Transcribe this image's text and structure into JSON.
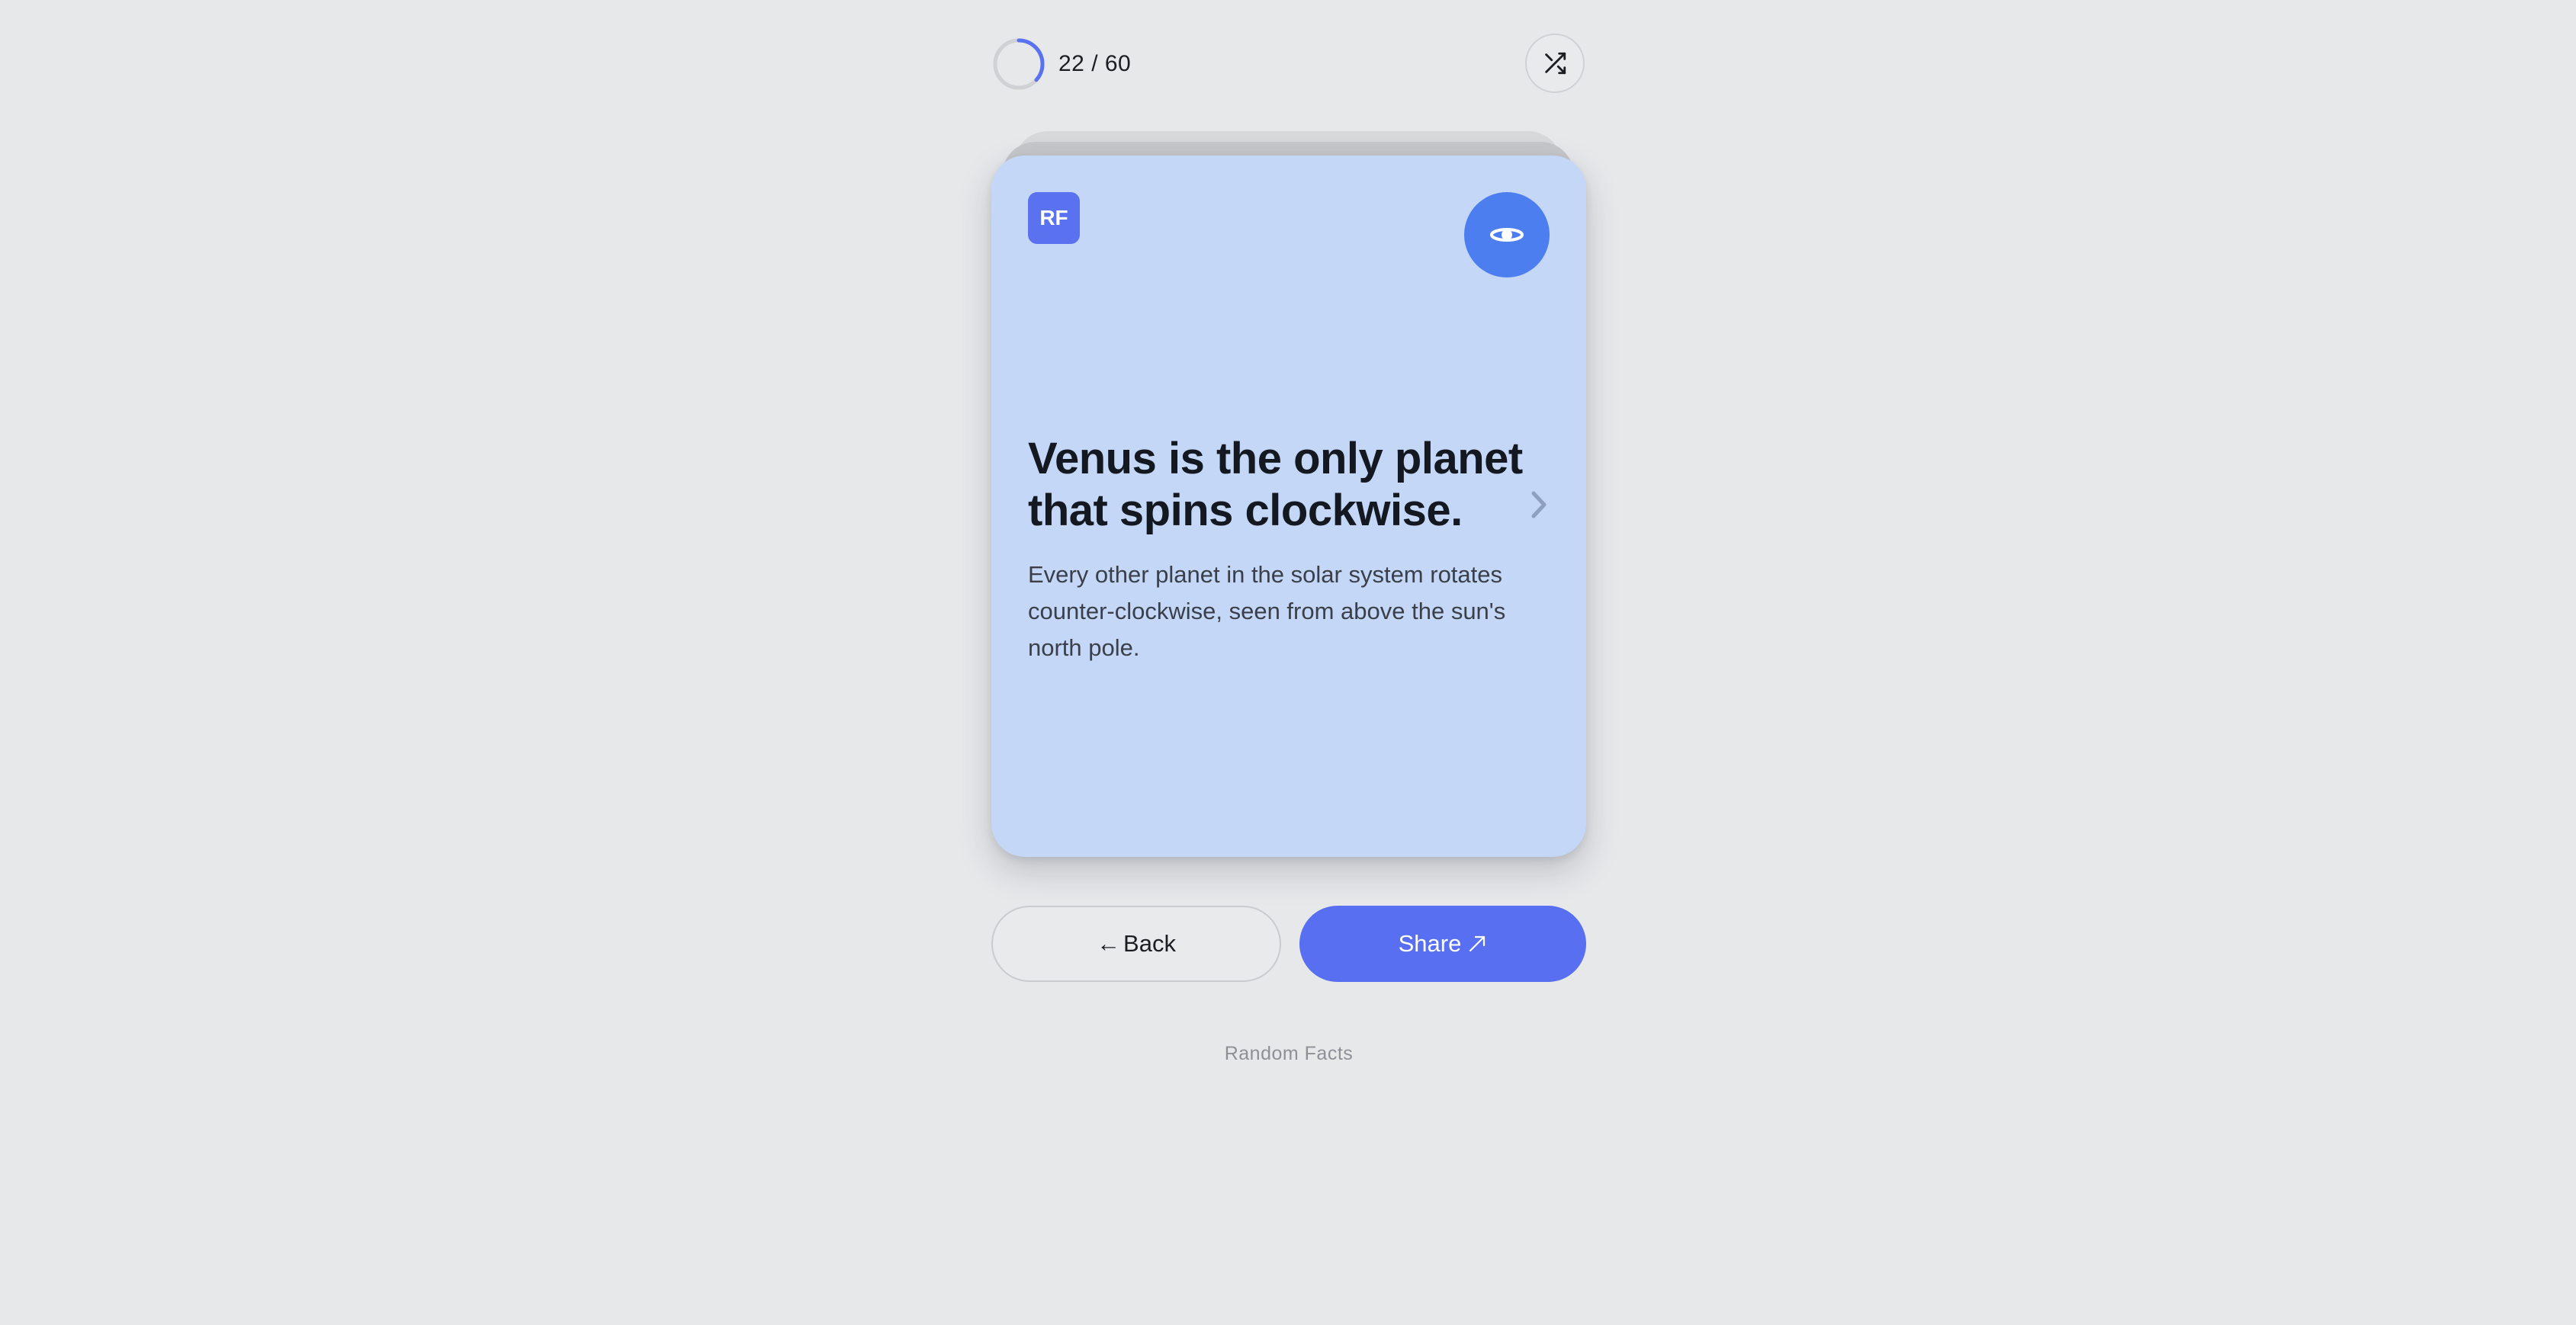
{
  "progress": {
    "current": 22,
    "total": 60,
    "label": "22 / 60",
    "fraction": 0.3667,
    "accent_color": "#5a72f0",
    "track_color": "#cfd1d5"
  },
  "toolbar": {
    "shuffle_icon": "shuffle-icon"
  },
  "card": {
    "badge": "RF",
    "category_icon": "planet-icon",
    "next_icon": "chevron-right-icon",
    "title": "Venus is the only planet that spins clockwise.",
    "body": "Every other planet in the solar system rotates counter-clockwise, seen from above the sun's north pole.",
    "background_color": "#c4d7f7",
    "icon_color": "#4d7ef0"
  },
  "actions": {
    "back_arrow": "←",
    "back_label": "Back",
    "share_label": "Share",
    "share_icon": "arrow-up-right-icon",
    "share_color": "#576ff0"
  },
  "footer": {
    "label": "Random Facts"
  }
}
